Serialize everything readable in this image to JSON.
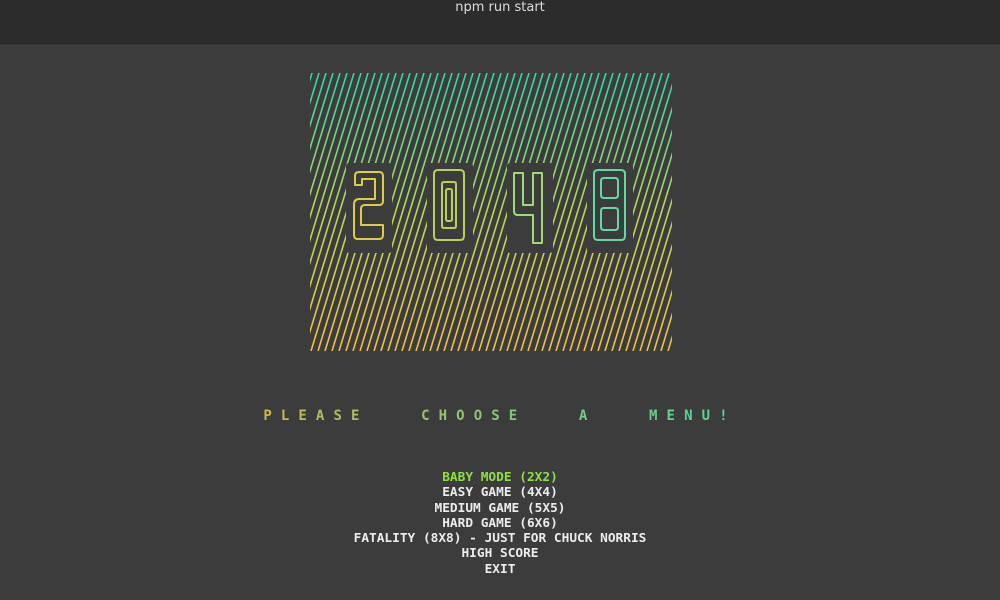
{
  "window": {
    "title": "npm run start"
  },
  "logo": {
    "digits": [
      "2",
      "0",
      "4",
      "8"
    ],
    "colors": {
      "gradient_start": "#f0c040",
      "gradient_mid": "#b8d855",
      "gradient_end": "#2fd6a8",
      "digit_colors": [
        "#dccd46",
        "#b6d058",
        "#9edb72",
        "#5fdaa0"
      ],
      "tile_bg": "#3c3c3c"
    }
  },
  "prompt": {
    "text": "PLEASE CHOOSE A MENU!",
    "gradient_start": "#c8b84a",
    "gradient_end": "#4fd69a"
  },
  "menu": {
    "selected_index": 0,
    "selected_color": "#8ee043",
    "items": [
      {
        "label": "BABY MODE (2X2)"
      },
      {
        "label": "EASY GAME (4X4)"
      },
      {
        "label": "MEDIUM GAME (5X5)"
      },
      {
        "label": "HARD GAME (6X6)"
      },
      {
        "label": "FATALITY (8X8) - JUST FOR CHUCK NORRIS"
      },
      {
        "label": "HIGH SCORE"
      },
      {
        "label": "EXIT"
      }
    ]
  }
}
